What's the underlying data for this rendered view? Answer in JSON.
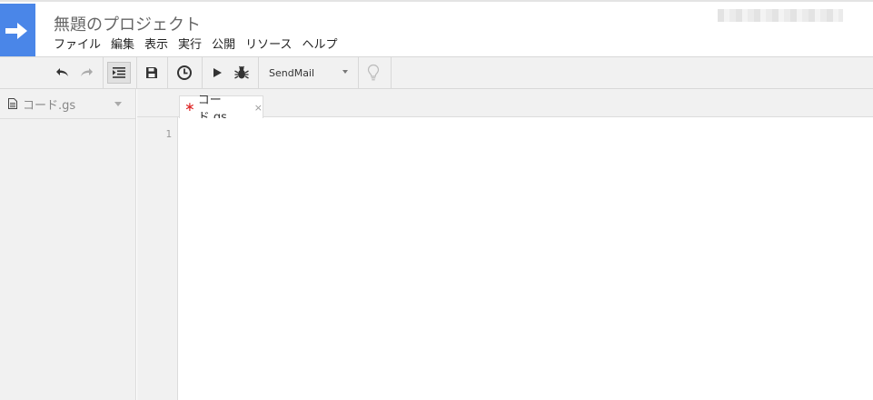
{
  "header": {
    "title": "無題のプロジェクト",
    "logo_color": "#4a86e8",
    "menu": [
      "ファイル",
      "編集",
      "表示",
      "実行",
      "公開",
      "リソース",
      "ヘルプ"
    ]
  },
  "toolbar": {
    "icons": [
      "undo-icon",
      "redo-icon",
      "indent-icon",
      "save-icon",
      "clock-icon",
      "play-icon",
      "bug-icon",
      "lightbulb-icon"
    ],
    "function_select": "SendMail"
  },
  "sidebar": {
    "files": [
      {
        "name": "コード.gs",
        "icon": "document-icon"
      }
    ]
  },
  "editor": {
    "tab": {
      "modified_marker": "∗",
      "name": "コード.gs",
      "close": "×"
    },
    "line_numbers": [
      "1"
    ]
  }
}
